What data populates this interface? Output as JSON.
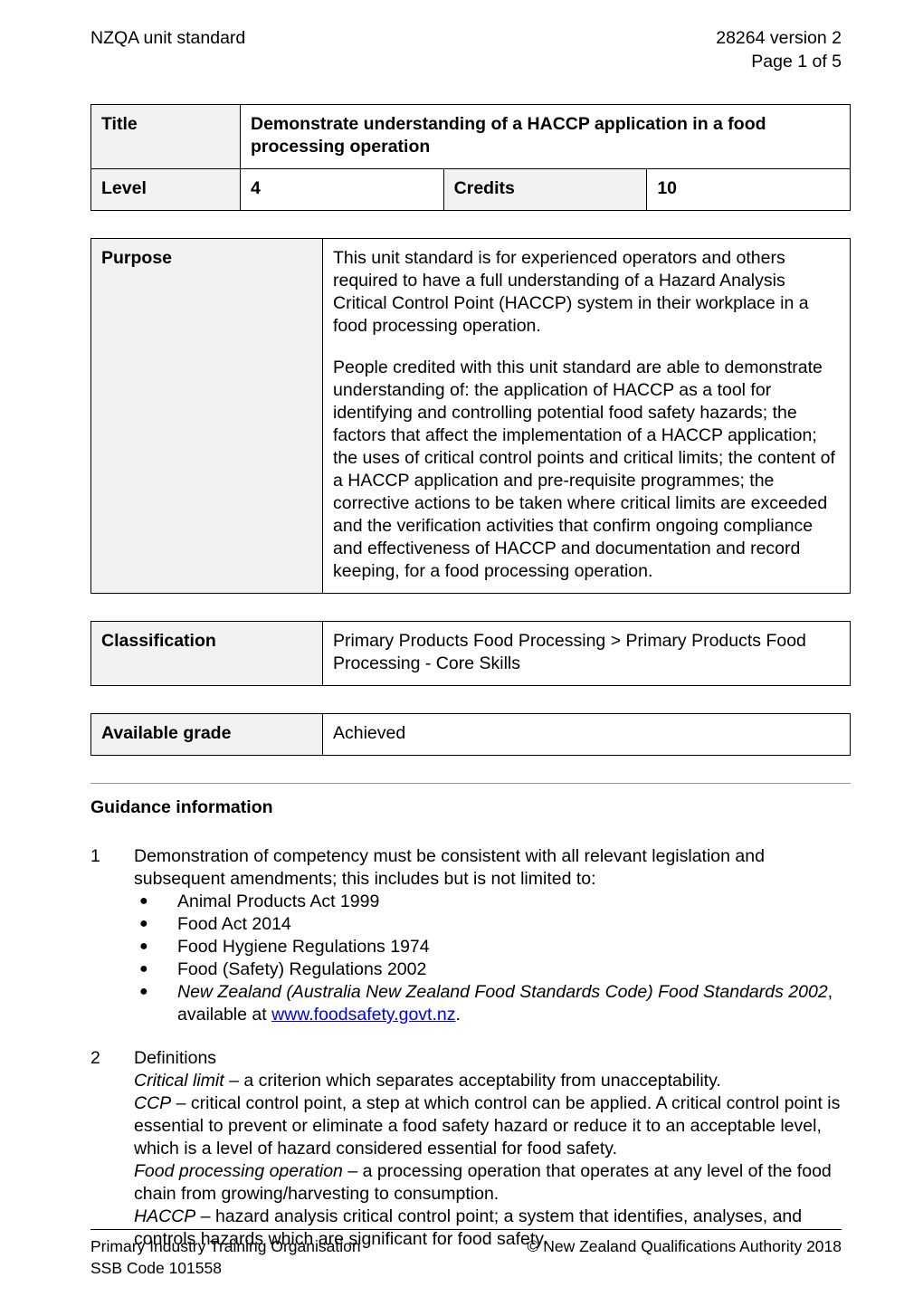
{
  "header": {
    "left": "NZQA unit standard",
    "standard_id": "28264 version 2",
    "page_label": "Page 1 of 5"
  },
  "title_table": {
    "title_label": "Title",
    "title_value": "Demonstrate understanding of a HACCP application in a food processing operation",
    "level_label": "Level",
    "level_value": "4",
    "credits_label": "Credits",
    "credits_value": "10"
  },
  "purpose": {
    "label": "Purpose",
    "paragraph_1": "This unit standard is for experienced operators and others required to have a full understanding of a Hazard Analysis Critical Control Point (HACCP) system in their workplace in a food processing operation.",
    "paragraph_2": "People credited with this unit standard are able to demonstrate understanding of: the application of HACCP as a tool for identifying and controlling potential food safety hazards; the factors that affect the implementation of a HACCP application; the uses of critical control points and critical limits; the content of a HACCP application and pre-requisite programmes; the corrective actions to be taken where critical limits are exceeded and the verification activities that confirm ongoing compliance and effectiveness of HACCP and documentation and record keeping, for a food processing operation."
  },
  "classification": {
    "label": "Classification",
    "value": "Primary Products Food Processing > Primary Products Food Processing - Core Skills"
  },
  "available_grade": {
    "label": "Available grade",
    "value": "Achieved"
  },
  "guidance": {
    "heading": "Guidance information",
    "item1": {
      "number": "1",
      "text": "Demonstration of competency must be consistent with all relevant legislation and subsequent amendments; this includes but is not limited to:",
      "bullets": [
        "Animal Products Act 1999",
        "Food Act 2014",
        "Food Hygiene Regulations 1974",
        "Food (Safety) Regulations 2002"
      ],
      "bullet_last": {
        "italic_part": "New Zealand (Australia New Zealand Food Standards Code) Food Standards 2002",
        "middle": ", available at ",
        "link_text": "www.foodsafety.govt.nz",
        "end": "."
      },
      "bullet_glyph": "●"
    },
    "item2": {
      "number": "2",
      "heading": "Definitions",
      "definitions": [
        {
          "term": "Critical limit",
          "text": " – a criterion which separates acceptability from unacceptability."
        },
        {
          "term": "CCP",
          "text": " – critical control point, a step at which control can be applied.  A critical control point is essential to prevent or eliminate a food safety hazard or reduce it to an acceptable level, which is a level of hazard considered essential for food safety."
        },
        {
          "term": "Food processing operation",
          "text": " – a processing operation that operates at any level of the food chain from growing/harvesting to consumption."
        },
        {
          "term": "HACCP",
          "text": " – hazard analysis critical control point; a system that identifies, analyses, and controls hazards which are significant for food safety."
        }
      ]
    }
  },
  "footer": {
    "organisation": "Primary Industry Training Organisation",
    "ssb_code": "SSB Code 101558",
    "copyright": "© New Zealand Qualifications Authority 2018"
  },
  "colors": {
    "label_cell_bg": "#f2f2f2",
    "border": "#000000",
    "link": "#0000ee",
    "rule": "#9a9a9a"
  }
}
